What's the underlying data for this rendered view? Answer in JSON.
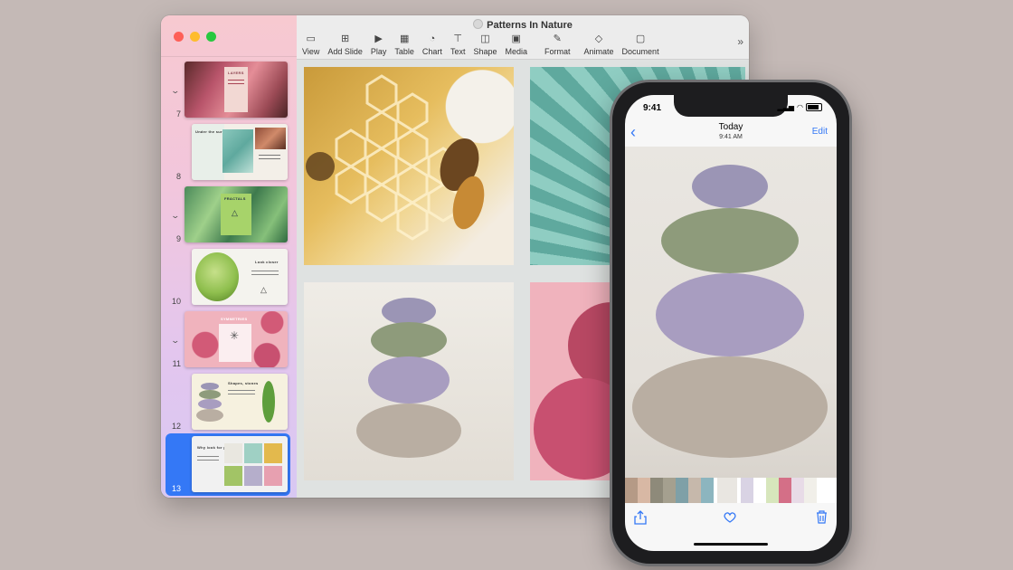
{
  "window": {
    "title": "Patterns In Nature",
    "toolbar": [
      {
        "label": "View",
        "icon": "sidebar-view-icon"
      },
      {
        "label": "Add Slide",
        "icon": "add-slide-icon"
      },
      {
        "label": "Play",
        "icon": "play-icon"
      },
      {
        "label": "Table",
        "icon": "table-icon"
      },
      {
        "label": "Chart",
        "icon": "chart-icon"
      },
      {
        "label": "Text",
        "icon": "text-box-icon"
      },
      {
        "label": "Shape",
        "icon": "shape-icon"
      },
      {
        "label": "Media",
        "icon": "media-icon"
      },
      {
        "label": "Format",
        "icon": "format-brush-icon"
      },
      {
        "label": "Animate",
        "icon": "animate-icon"
      },
      {
        "label": "Document",
        "icon": "document-icon"
      }
    ],
    "more_icon": "»"
  },
  "slides": [
    {
      "num": "7",
      "label": "LAYERS",
      "collapsible": true
    },
    {
      "num": "8",
      "label": "Under the surface",
      "collapsible": false
    },
    {
      "num": "9",
      "label": "FRACTALS",
      "collapsible": true
    },
    {
      "num": "10",
      "label": "Look closer",
      "collapsible": false
    },
    {
      "num": "11",
      "label": "SYMMETRIES",
      "collapsible": true
    },
    {
      "num": "12",
      "label": "Shapes, stones",
      "collapsible": false
    },
    {
      "num": "13",
      "label": "Why look for patterns",
      "collapsible": false,
      "selected": true
    }
  ],
  "phone": {
    "time": "9:41",
    "nav_title": "Today",
    "nav_subtitle": "9:41 AM",
    "edit_label": "Edit",
    "filmstrip_colors": [
      "#b59a86",
      "#d8b8a4",
      "#8e8a7a",
      "#a5a08f",
      "#7fa0a7",
      "#c6b8ab",
      "#8cb5bf",
      "#e9e6e1",
      "#d9d3e4",
      "#ffffff",
      "#d7e6bc",
      "#d46f87",
      "#e8dbe7",
      "#f1efe9"
    ]
  }
}
